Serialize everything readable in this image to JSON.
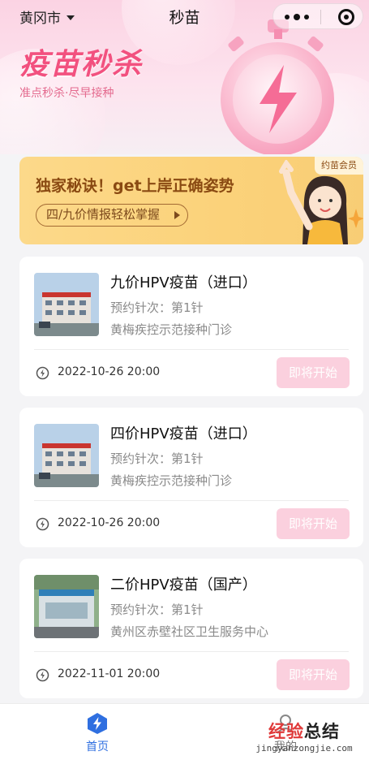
{
  "topbar": {
    "city": "黄冈市",
    "title": "秒苗"
  },
  "hero": {
    "title": "疫苗秒杀",
    "subtitle": "准点秒杀·尽早接种"
  },
  "banner": {
    "title": "独家秘诀！get上岸正确姿势",
    "pill": "四/九价情报轻松掌握",
    "tag": "约苗会员"
  },
  "cards": [
    {
      "name": "九价HPV疫苗（进口）",
      "dose": "预约针次：第1针",
      "site": "黄梅疾控示范接种门诊",
      "time": "2022-10-26 20:00",
      "button": "即将开始"
    },
    {
      "name": "四价HPV疫苗（进口）",
      "dose": "预约针次：第1针",
      "site": "黄梅疾控示范接种门诊",
      "time": "2022-10-26 20:00",
      "button": "即将开始"
    },
    {
      "name": "二价HPV疫苗（国产）",
      "dose": "预约针次：第1针",
      "site": "黄州区赤壁社区卫生服务中心",
      "time": "2022-11-01 20:00",
      "button": "即将开始"
    }
  ],
  "tabbar": {
    "home": "首页",
    "mine": "我的"
  },
  "watermark": {
    "cn_a": "经验",
    "cn_b": "总结",
    "url": "jingyanzongjie.com"
  },
  "colors": {
    "accent": "#f2517f",
    "tab_active": "#2f6fe0",
    "button_disabled": "#fbd0de",
    "banner": "#fbd27a"
  },
  "icons": {
    "more": "more-dots-icon",
    "close": "mini-program-close-icon",
    "time": "lightning-clock-icon",
    "home": "home-bolt-icon",
    "mine": "user-icon"
  }
}
